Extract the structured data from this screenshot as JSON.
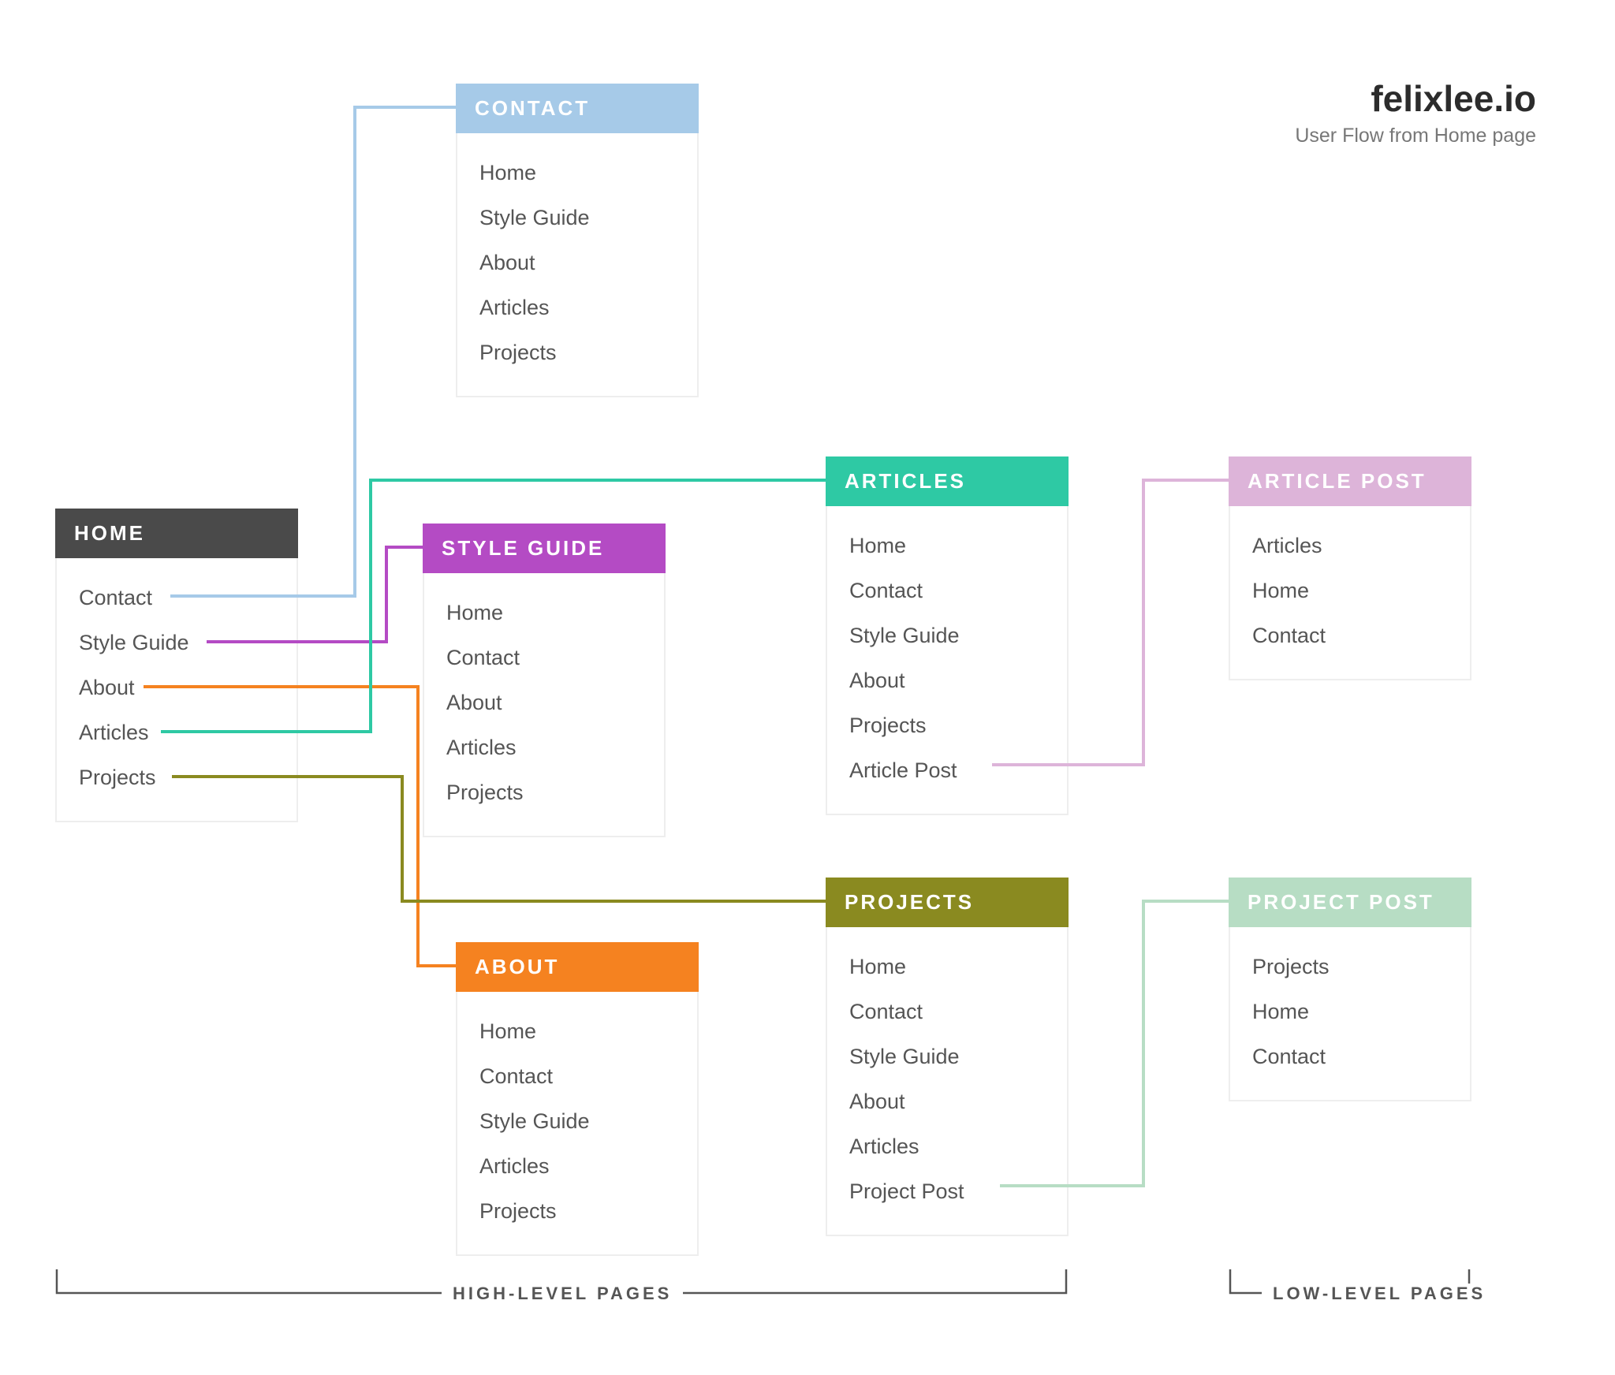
{
  "branding": {
    "site": "felixlee.io",
    "tagline": "User Flow from Home page"
  },
  "section_labels": {
    "high": "HIGH-LEVEL PAGES",
    "low": "LOW-LEVEL PAGES"
  },
  "colors": {
    "home": "#4a4a4a",
    "contact": "#a6cae8",
    "style_guide": "#b44bc4",
    "about": "#f58220",
    "articles": "#2ec9a4",
    "projects": "#8a8a20",
    "article_post": "#ddb4d9",
    "project_post": "#b7ddc4",
    "card_border": "#eeeeee"
  },
  "cards": {
    "home": {
      "title": "HOME",
      "items": [
        "Contact",
        "Style Guide",
        "About",
        "Articles",
        "Projects"
      ]
    },
    "contact": {
      "title": "CONTACT",
      "items": [
        "Home",
        "Style Guide",
        "About",
        "Articles",
        "Projects"
      ]
    },
    "style_guide": {
      "title": "STYLE GUIDE",
      "items": [
        "Home",
        "Contact",
        "About",
        "Articles",
        "Projects"
      ]
    },
    "about": {
      "title": "ABOUT",
      "items": [
        "Home",
        "Contact",
        "Style Guide",
        "Articles",
        "Projects"
      ]
    },
    "articles": {
      "title": "ARTICLES",
      "items": [
        "Home",
        "Contact",
        "Style Guide",
        "About",
        "Projects",
        "Article Post"
      ]
    },
    "projects": {
      "title": "PROJECTS",
      "items": [
        "Home",
        "Contact",
        "Style Guide",
        "About",
        "Articles",
        "Project Post"
      ]
    },
    "article_post": {
      "title": "ARTICLE POST",
      "items": [
        "Articles",
        "Home",
        "Contact"
      ]
    },
    "project_post": {
      "title": "PROJECT POST",
      "items": [
        "Projects",
        "Home",
        "Contact"
      ]
    }
  }
}
